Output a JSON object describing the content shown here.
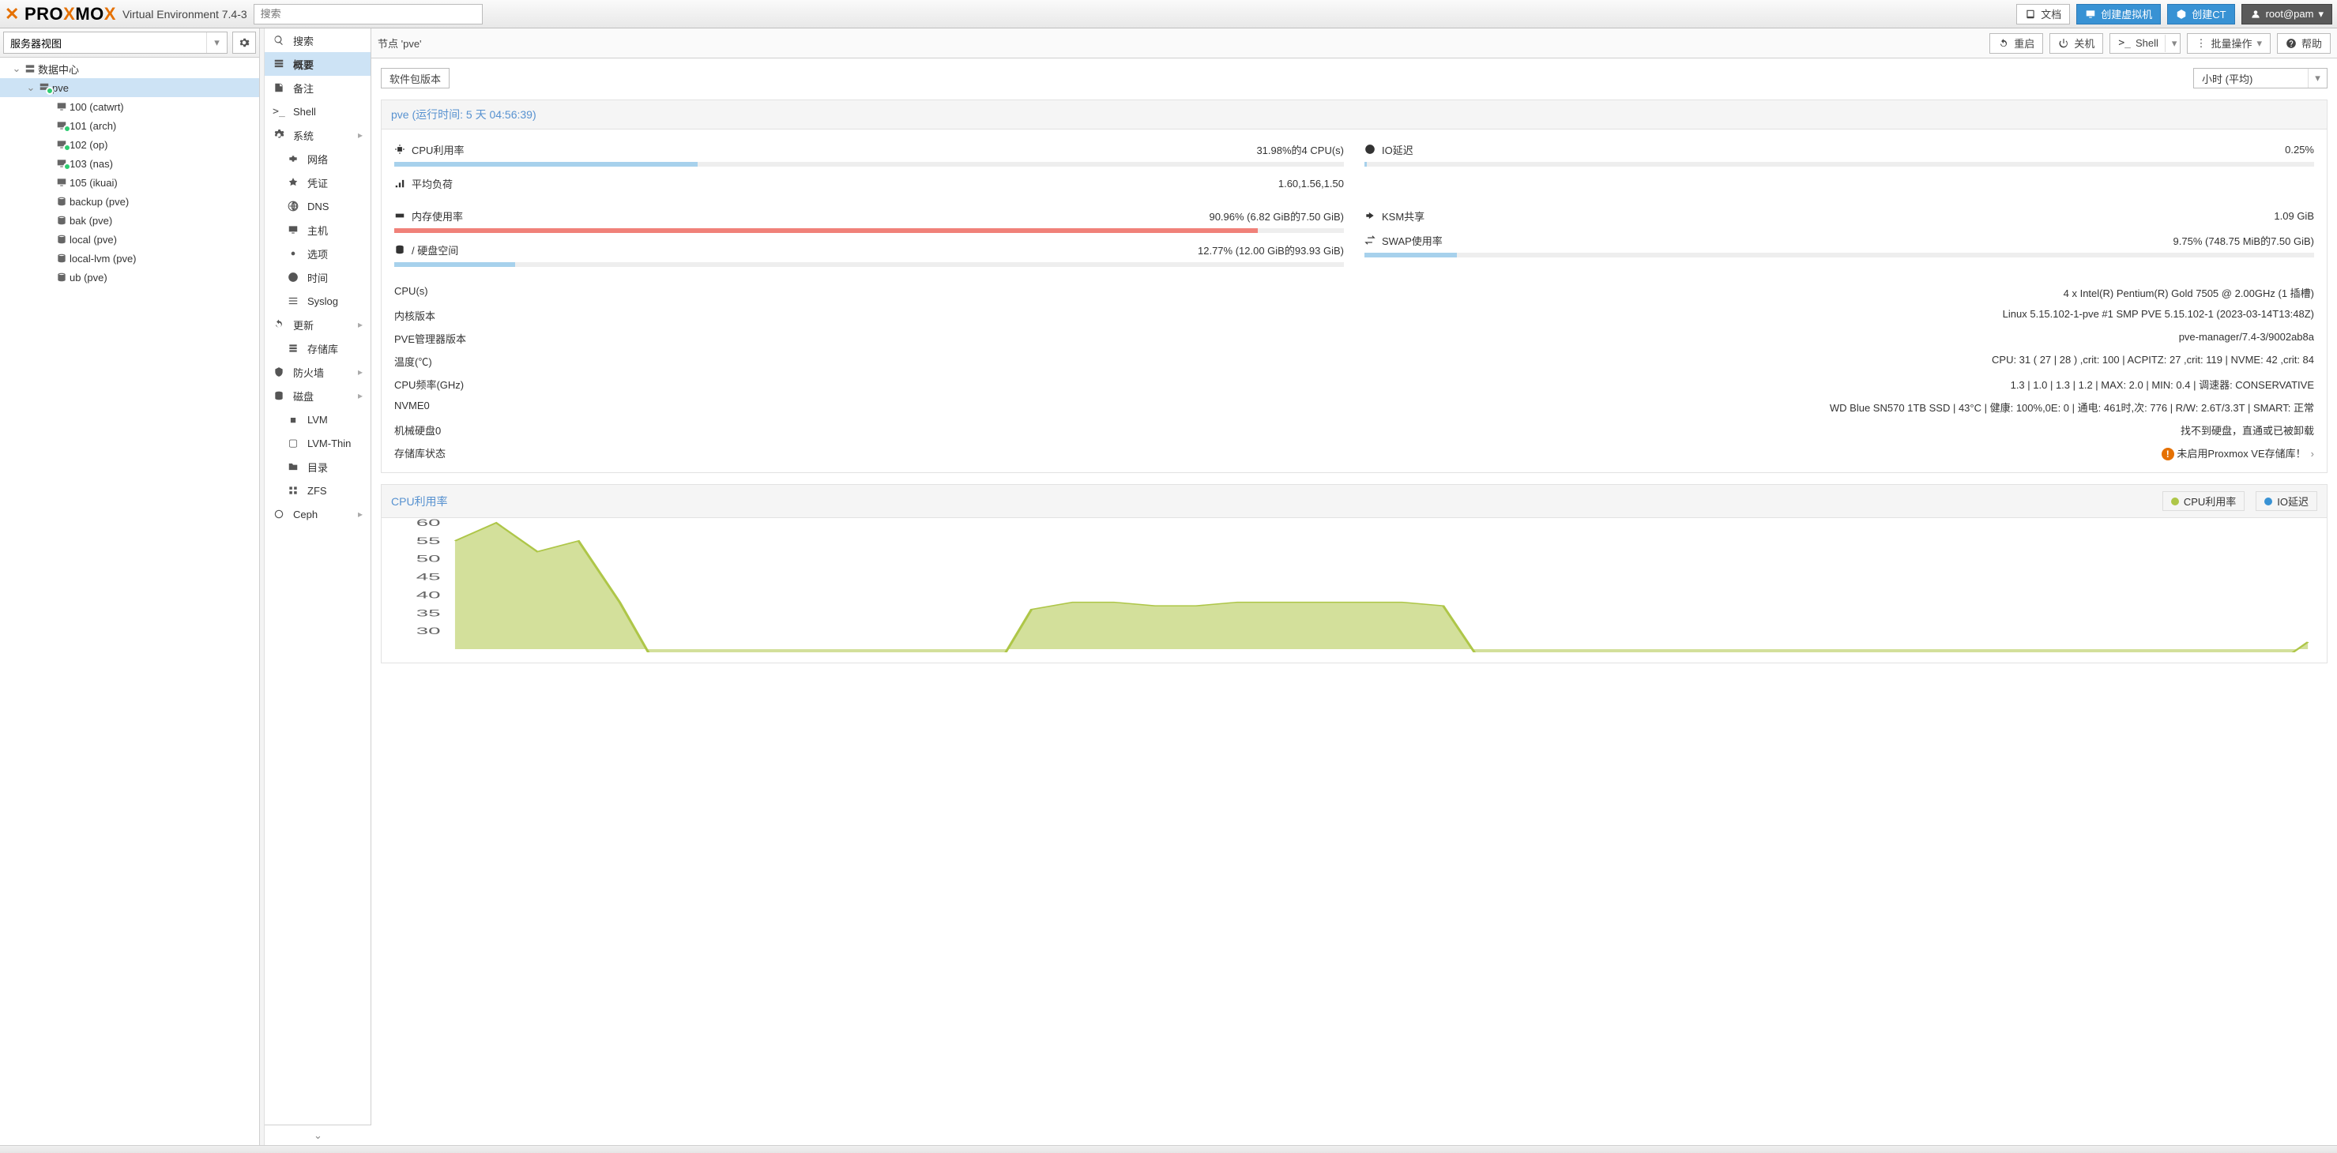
{
  "header": {
    "product": "PROXMOX",
    "subtitle": "Virtual Environment 7.4-3",
    "search_placeholder": "搜索",
    "docs": "文档",
    "create_vm": "创建虚拟机",
    "create_ct": "创建CT",
    "user": "root@pam"
  },
  "tree": {
    "view_label": "服务器视图",
    "root": "数据中心",
    "node": "pve",
    "guests": [
      {
        "id": "100",
        "name": "catwrt",
        "running": false
      },
      {
        "id": "101",
        "name": "arch",
        "running": true
      },
      {
        "id": "102",
        "name": "op",
        "running": true
      },
      {
        "id": "103",
        "name": "nas",
        "running": true
      },
      {
        "id": "105",
        "name": "ikuai",
        "running": false
      }
    ],
    "storages": [
      {
        "name": "backup (pve)"
      },
      {
        "name": "bak (pve)"
      },
      {
        "name": "local (pve)"
      },
      {
        "name": "local-lvm (pve)"
      },
      {
        "name": "ub (pve)"
      }
    ]
  },
  "node_toolbar": {
    "title": "节点 'pve'",
    "reboot": "重启",
    "shutdown": "关机",
    "shell": "Shell",
    "bulk": "批量操作",
    "help": "帮助"
  },
  "nav": {
    "search": "搜索",
    "summary": "概要",
    "notes": "备注",
    "shell": "Shell",
    "system": "系统",
    "network": "网络",
    "certs": "凭证",
    "dns": "DNS",
    "hosts": "主机",
    "options": "选项",
    "time": "时间",
    "syslog": "Syslog",
    "updates": "更新",
    "repos": "存储库",
    "firewall": "防火墙",
    "disks": "磁盘",
    "lvm": "LVM",
    "lvmthin": "LVM-Thin",
    "dir": "目录",
    "zfs": "ZFS",
    "ceph": "Ceph"
  },
  "subbar": {
    "pkgver": "软件包版本",
    "timerange": "小时 (平均)"
  },
  "summary": {
    "title": "pve (运行时间: 5 天 04:56:39)",
    "cpu": {
      "label": "CPU利用率",
      "value": "31.98%的4 CPU(s)",
      "pct": 31.98,
      "color": "blue"
    },
    "load": {
      "label": "平均负荷",
      "value": "1.60,1.56,1.50"
    },
    "io": {
      "label": "IO延迟",
      "value": "0.25%",
      "pct": 0.25,
      "color": "blue"
    },
    "mem": {
      "label": "内存使用率",
      "value": "90.96% (6.82 GiB的7.50 GiB)",
      "pct": 90.96,
      "color": "red"
    },
    "ksm": {
      "label": "KSM共享",
      "value": "1.09 GiB"
    },
    "disk": {
      "label": "/ 硬盘空间",
      "value": "12.77% (12.00 GiB的93.93 GiB)",
      "pct": 12.77,
      "color": "blue"
    },
    "swap": {
      "label": "SWAP使用率",
      "value": "9.75% (748.75 MiB的7.50 GiB)",
      "pct": 9.75,
      "color": "blue"
    }
  },
  "info": {
    "cpus": {
      "k": "CPU(s)",
      "v": "4 x Intel(R) Pentium(R) Gold 7505 @ 2.00GHz (1 插槽)"
    },
    "kernel": {
      "k": "内核版本",
      "v": "Linux 5.15.102-1-pve #1 SMP PVE 5.15.102-1 (2023-03-14T13:48Z)"
    },
    "mgr": {
      "k": "PVE管理器版本",
      "v": "pve-manager/7.4-3/9002ab8a"
    },
    "temp": {
      "k": "温度(℃)",
      "v": "CPU: 31 ( 27 | 28 ) ,crit: 100 | ACPITZ: 27 ,crit: 119 | NVME: 42 ,crit: 84"
    },
    "freq": {
      "k": "CPU频率(GHz)",
      "v": "1.3 | 1.0 | 1.3 | 1.2 | MAX: 2.0 | MIN: 0.4 | 调速器: CONSERVATIVE"
    },
    "nvme": {
      "k": "NVME0",
      "v": "WD Blue SN570 1TB SSD | 43°C | 健康: 100%,0E: 0 | 通电: 461时,次: 776 | R/W: 2.6T/3.3T | SMART: 正常"
    },
    "hdd": {
      "k": "机械硬盘0",
      "v": "找不到硬盘，直通或已被卸载"
    },
    "repo": {
      "k": "存储库状态",
      "v": "未启用Proxmox VE存储库！"
    }
  },
  "chart": {
    "title": "CPU利用率",
    "legend": {
      "cpu": "CPU利用率",
      "io": "IO延迟"
    }
  },
  "chart_data": {
    "type": "area",
    "title": "CPU利用率",
    "ylabel": "%",
    "ylim": [
      0,
      60
    ],
    "yticks": [
      30,
      35,
      40,
      45,
      50,
      55,
      60
    ],
    "series": [
      {
        "name": "CPU利用率",
        "color": "#aec648",
        "values": [
          55,
          60,
          52,
          55,
          38,
          18,
          17,
          17,
          17,
          17,
          17,
          17,
          17,
          17,
          36,
          38,
          38,
          37,
          37,
          38,
          38,
          38,
          38,
          38,
          37,
          20,
          18,
          18,
          18,
          18,
          17,
          17,
          17,
          17,
          17,
          17,
          17,
          17,
          17,
          17,
          17,
          17,
          17,
          17,
          19,
          27
        ]
      },
      {
        "name": "IO延迟",
        "color": "#3892d4",
        "values": [
          0,
          0,
          0,
          0,
          0,
          0,
          0,
          0,
          0,
          0,
          0,
          0,
          0,
          0,
          0,
          0,
          0,
          0,
          0,
          0,
          0,
          0,
          0,
          0,
          0,
          0,
          0,
          0,
          0,
          0,
          0,
          0,
          0,
          0,
          0,
          0,
          0,
          0,
          0,
          0,
          0,
          0,
          0,
          0,
          0,
          0
        ]
      }
    ]
  }
}
